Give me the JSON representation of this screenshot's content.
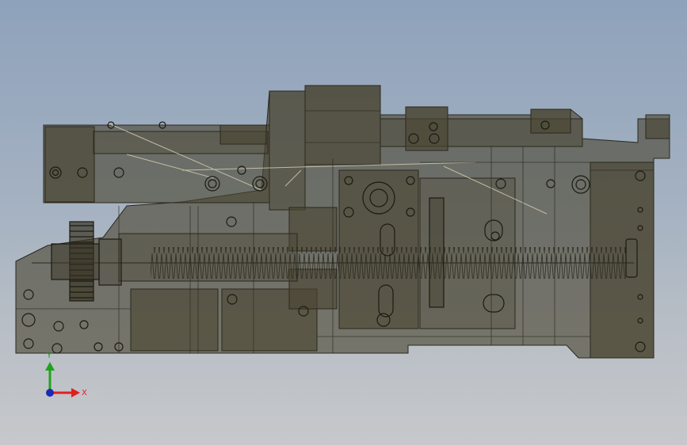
{
  "viewport": {
    "background": {
      "top": "#8ea2bb",
      "bottom": "#c6c8cb"
    },
    "model_fill": "#4a4532",
    "model_fill_opacity": 0.62,
    "line_color": "#2b281d",
    "highlight_line": "#d8d3b4"
  },
  "triad": {
    "x_label": "X",
    "y_label": "Y",
    "x_color": "#e02020",
    "y_color": "#1fa31f",
    "z_color": "#1e2ab4"
  }
}
